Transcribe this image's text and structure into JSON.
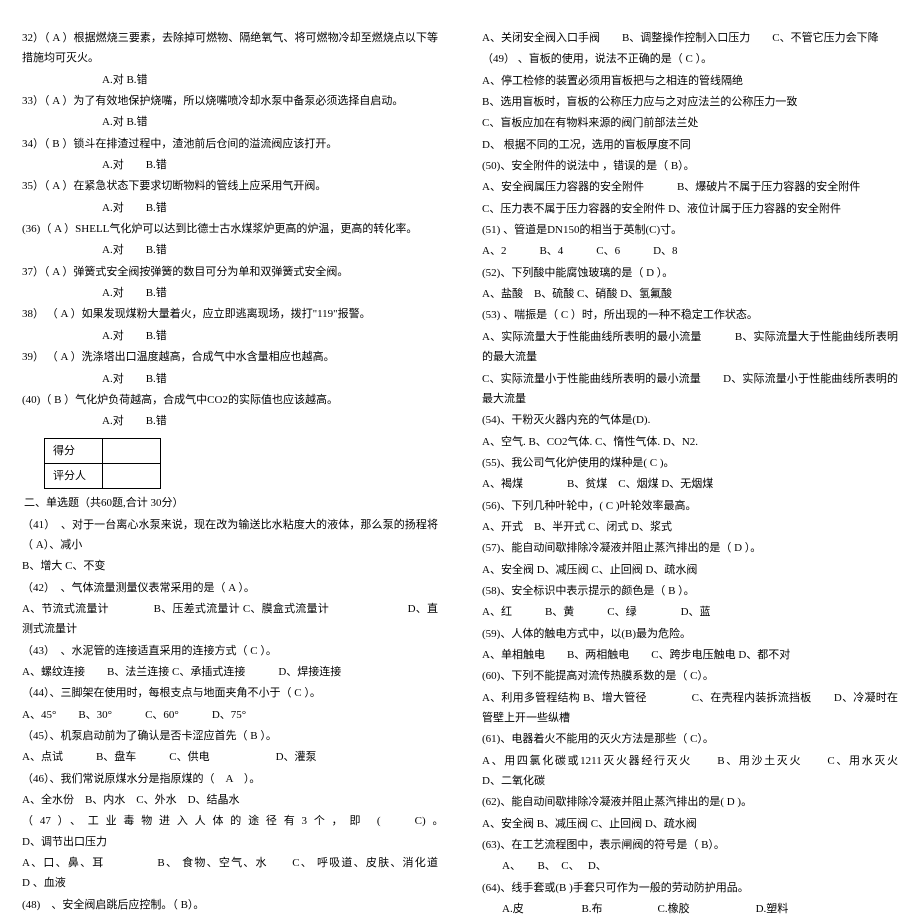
{
  "left": {
    "q32": "32）（ A ）根据燃烧三要素，去除掉可燃物、隔绝氧气、将可燃物冷却至燃烧点以下等措施均可灭火。",
    "o32": "A.对  B.错",
    "q33": "33）（ A ）为了有效地保护烧嘴，所以烧嘴喷冷却水泵中备泵必须选择自启动。",
    "o33": "A.对  B.错",
    "q34": "34）（ B ）锁斗在排渣过程中，渣池前后仓间的溢流阀应该打开。",
    "o34": "A.对　　B.错",
    "q35": "35）（ A ）在紧急状态下要求切断物料的管线上应采用气开阀。",
    "o35": "A.对　　B.错",
    "q36": "(36)（ A ）SHELL气化炉可以达到比德士古水煤浆炉更高的炉温，更高的转化率。",
    "o36": "A.对　　B.错",
    "q37": "37）（ A ）弹簧式安全阀按弹簧的数目可分为单和双弹簧式安全阀。",
    "o37": "A.对　　B.错",
    "q38": "38） （ A ）如果发现煤粉大量着火，应立即逃离现场，拨打\"119\"报警。",
    "o38": "A.对　　B.错",
    "q39": "39） （ A ）洗涤塔出口温度越高，合成气中水含量相应也越高。",
    "o39": "A.对　　B.错",
    "q40": "(40)（ B ）气化炉负荷越高，合成气中CO2的实际值也应该越高。",
    "o40": "A.对　　B.错",
    "score": {
      "r1": "得分",
      "r2": "评分人"
    },
    "section2": "二、单选题（共60题,合计 30分）",
    "q41": "（41）　、对于一台离心水泵来说，现在改为输送比水粘度大的液体，那么泵的扬程将（ A）、减小",
    "q41b": "B、增大 C、不变",
    "q42": "（42）　、气体流量测量仪表常采用的是（ A ）。",
    "o42": "A、节流式流量计　　　　B、压差式流量计  C、膜盒式流量计　　　　　　　D、直测式流量计",
    "q43": "（43）　、水泥管的连接适直采用的连接方式（ C ）。",
    "o43": "A、螺纹连接　　B、法兰连接  C、承插式连接　　　D、焊接连接",
    "q44": "（44）、三脚架在使用时，每根支点与地面夹角不小于（ C ）。",
    "o44": "A、45°　　B、30°　　　C、60°　　　D、75°",
    "q45": "（45）、机泵启动前为了确认是否卡涩应首先（ B ）。",
    "o45": "A、点试　　　B、盘车　　　C、供电　　　　　　D、灌泵",
    "q46": "（46）、我们常说原煤水分是指原煤的（　A　）。",
    "o46": "A、全水份　B、内水　C、外水　D、结晶水",
    "q47": "（47）、工业毒物进入人体的途径有3个，即 (　 C)。　　　　　　　　　　　　　　D、调节出口压力",
    "o47": "A、口、鼻、耳 　　　　B、 食物、空气、水　　C、 呼吸道、皮肤、消化道　　　　　D 、血液",
    "q48": "(48)　、安全阀启跳后应控制。（ B）。"
  },
  "right": {
    "r1": "A、关闭安全阀入口手阀　　B、调整操作控制入口压力　　C、不管它压力会下降",
    "r2": "（49） 、盲板的使用，说法不正确的是（ C ）。",
    "r2a": "A、停工检修的装置必须用盲板把与之相连的管线隔绝",
    "r2b": "B、选用盲板时，盲板的公称压力应与之对应法兰的公称压力一致",
    "r2c": "C、盲板应加在有物料来源的阀门前部法兰处",
    "r2d": "D、 根据不同的工况，选用的盲板厚度不同",
    "r3": "(50)、安全附件的说法中 ，错误的是（ B）。",
    "r3a": "A、安全阀属压力容器的安全附件　　　B、爆破片不属于压力容器的安全附件",
    "r3b": "C、压力表不属于压力容器的安全附件 D、液位计属于压力容器的安全附件",
    "r4": "(51) 、管道是DN150的相当于英制(C)寸。",
    "r4o": "A、2　　　B、4　　　C、6　　　D、8",
    "r5": "(52)、下列酸中能腐蚀玻璃的是（ D ）。",
    "r5o": "A、盐酸　B、硫酸  C、硝酸  D、氢氟酸",
    "r6": "(53) 、喘振是（ C ）时，所出现的一种不稳定工作状态。",
    "r6a": "A、实际流量大于性能曲线所表明的最小流量　　　B、实际流量大于性能曲线所表明的最大流量",
    "r6b": "C、实际流量小于性能曲线所表明的最小流量　　D、实际流量小于性能曲线所表明的最大流量",
    "r7": "(54)、干粉灭火器内充的气体是(D).",
    "r7o": "A、空气. B、CO2气体. C、惰性气体. D、N2.",
    "r8": "(55)、我公司气化炉使用的煤种是( C )。",
    "r8o": "A、褐煤　　　　B、贫煤　C、烟煤 D、无烟煤",
    "r9": "(56)、下列几种叶轮中，(  C  )叶轮效率最高。",
    "r9o": "A、开式　B、半开式 C、闭式 D、浆式",
    "r10": "(57)、能自动间歇排除冷凝液并阻止蒸汽排出的是（ D ）。",
    "r10o": "A、安全阀 D、减压阀 C、止回阀 D、疏水阀",
    "r11": "(58)、安全标识中表示提示的颜色是（ B ）。",
    "r11o": "A、红　　　B、黄　　　C、绿　　　　D、蓝",
    "r12": "(59)、人体的触电方式中，以(B)最为危险。",
    "r12o": "A、单相触电　　B、两相触电　　C、跨步电压触电 D、都不对",
    "r13": "(60)、下列不能提高对流传热膜系数的是（ C）。",
    "r13a": "A、利用多管程结构 B、增大管径　　　　C、在壳程内装拆流挡板　　D、冷凝时在管壁上开一些纵槽",
    "r14": "(61)、电器着火不能用的灭火方法是那些（ C）。",
    "r14o": "A、用四氯化碳或1211灭火器经行灭火　　B、用沙土灭火　　C、用水灭火　　　　D、二氧化碳",
    "r15": "(62)、能自动间歇排除冷凝液并阻止蒸汽排出的是( D )。",
    "r15o": "A、安全阀  B、减压阀 C、止回阀 D、疏水阀",
    "r16": "(63)、在工艺流程图中，表示闸阀的符号是（ B）。",
    "r16o": "A、　　B、　C、　 D、",
    "r17": "(64)、线手套或(B  )手套只可作为一般的劳动防护用品。",
    "r17o": "A.皮 　　　　　B.布　　　　　C.橡胶　　　　　　D.塑料"
  }
}
